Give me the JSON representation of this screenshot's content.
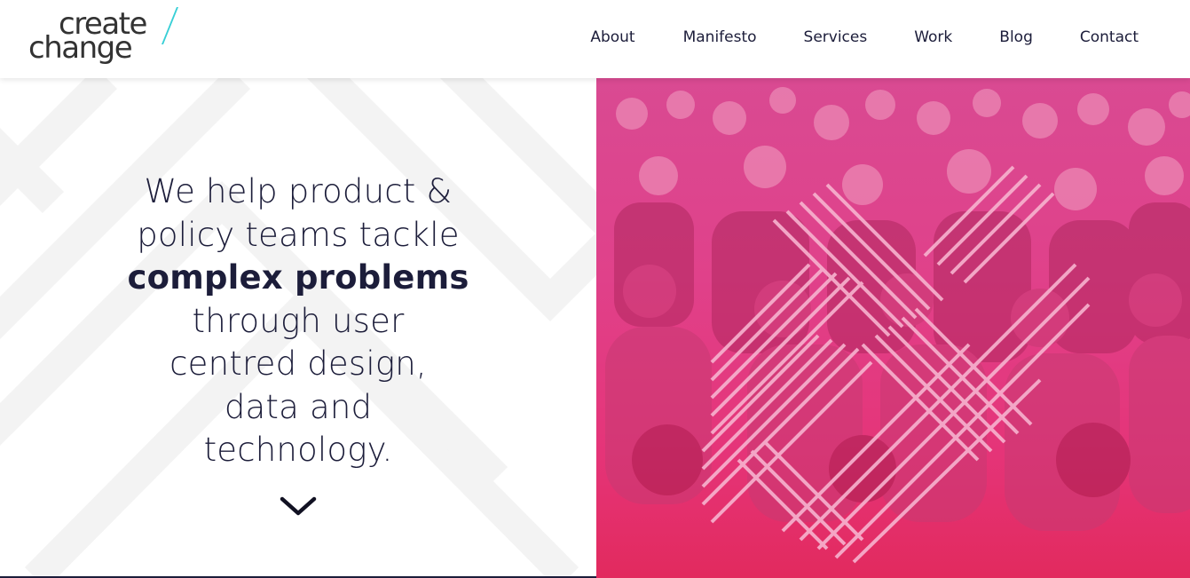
{
  "logo": {
    "line1": "create",
    "line2": "change"
  },
  "nav": {
    "items": [
      {
        "label": "About"
      },
      {
        "label": "Manifesto"
      },
      {
        "label": "Services"
      },
      {
        "label": "Work"
      },
      {
        "label": "Blog"
      },
      {
        "label": "Contact"
      }
    ]
  },
  "hero": {
    "line1": "We help product &",
    "line2": "policy teams tackle",
    "emphasis": "complex problems",
    "line3": "through user",
    "line4": "centred design,",
    "line5": "data and",
    "line6": "technology.",
    "scroll_icon": "chevron-down-icon",
    "image_description": "crowd-photo"
  },
  "colors": {
    "text": "#1c1d3a",
    "accent_cyan": "#38cfd6",
    "image_pink": "#e0418a",
    "image_red": "#e22a5e",
    "logo_gray": "#333333"
  }
}
